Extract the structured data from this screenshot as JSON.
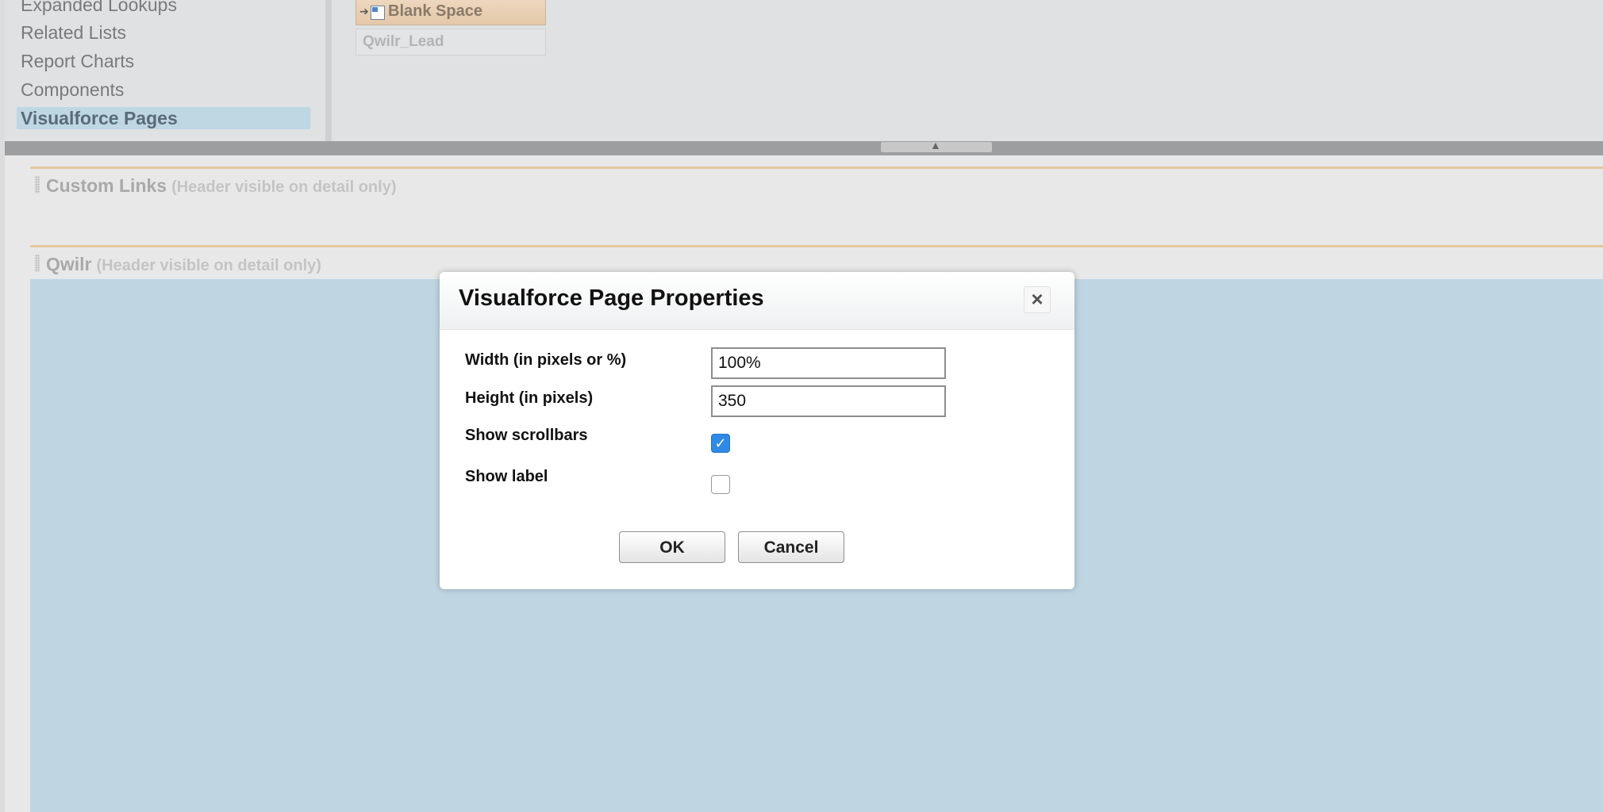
{
  "palette": {
    "categories": [
      {
        "label": "Expanded Lookups"
      },
      {
        "label": "Related Lists"
      },
      {
        "label": "Report Charts"
      },
      {
        "label": "Components"
      },
      {
        "label": "Visualforce Pages",
        "selected": true
      }
    ],
    "items": {
      "blank_space": "Blank Space",
      "qwilr_lead": "Qwilr_Lead"
    }
  },
  "layout": {
    "custom_links": {
      "title": "Custom Links",
      "note": "(Header visible on detail only)"
    },
    "qwilr": {
      "title": "Qwilr",
      "note": "(Header visible on detail only)"
    }
  },
  "dialog": {
    "title": "Visualforce Page Properties",
    "close_glyph": "×",
    "width_label": "Width (in pixels or %)",
    "width_value": "100%",
    "height_label": "Height (in pixels)",
    "height_value": "350",
    "scrollbars_label": "Show scrollbars",
    "scrollbars_checked": true,
    "checkmark_glyph": "✓",
    "show_label_label": "Show label",
    "show_label_checked": false,
    "ok_label": "OK",
    "cancel_label": "Cancel"
  },
  "colors": {
    "selected_category": "#bfd6e3",
    "visualforce_area": "#bfd5e2",
    "section_rule": "#e2c8a0",
    "checkbox_checked": "#2f8ae5"
  }
}
